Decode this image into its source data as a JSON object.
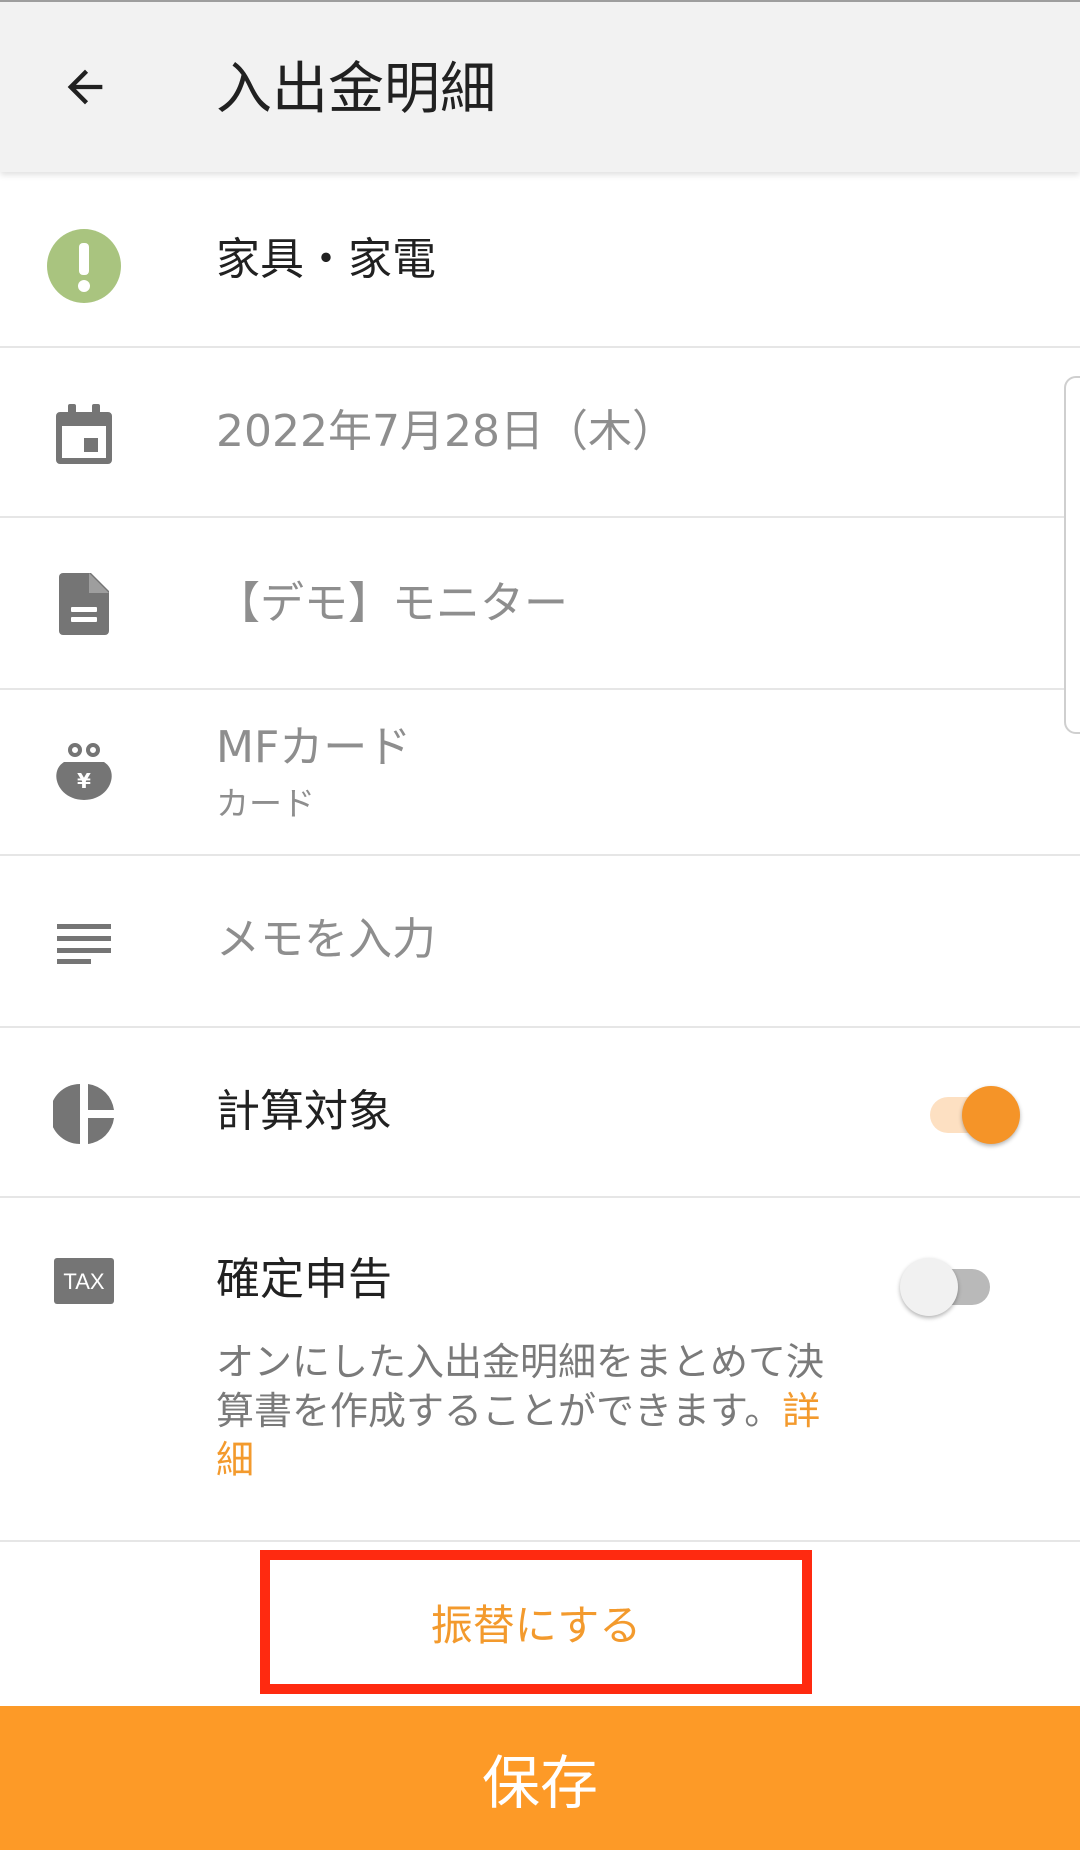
{
  "appbar": {
    "title": "入出金明細",
    "back_icon": "arrow-back-icon"
  },
  "rows": {
    "category": {
      "label": "家具・家電",
      "icon": "exclamation-circle-icon",
      "icon_color": "#a9c47f"
    },
    "date": {
      "value": "2022年7月28日（木）",
      "icon": "calendar-icon"
    },
    "content": {
      "value": "【デモ】モニター",
      "icon": "document-icon"
    },
    "account": {
      "name": "MFカード",
      "type": "カード",
      "icon": "wallet-yen-icon"
    },
    "memo": {
      "placeholder": "メモを入力",
      "icon": "notes-icon"
    },
    "calc_target": {
      "label": "計算対象",
      "icon": "pie-chart-icon",
      "enabled": true
    },
    "tax_return": {
      "label": "確定申告",
      "icon": "tax-icon",
      "icon_text": "TAX",
      "enabled": false,
      "description": "オンにした入出金明細をまとめて決算書を作成することができます。",
      "link": "詳細"
    }
  },
  "transfer_button": "振替にする",
  "save_button": "保存",
  "colors": {
    "accent": "#f39a2d",
    "save_bar": "#fd9a27",
    "highlight_box": "#ff2a10",
    "toggle_on_track": "#fde0c2"
  }
}
